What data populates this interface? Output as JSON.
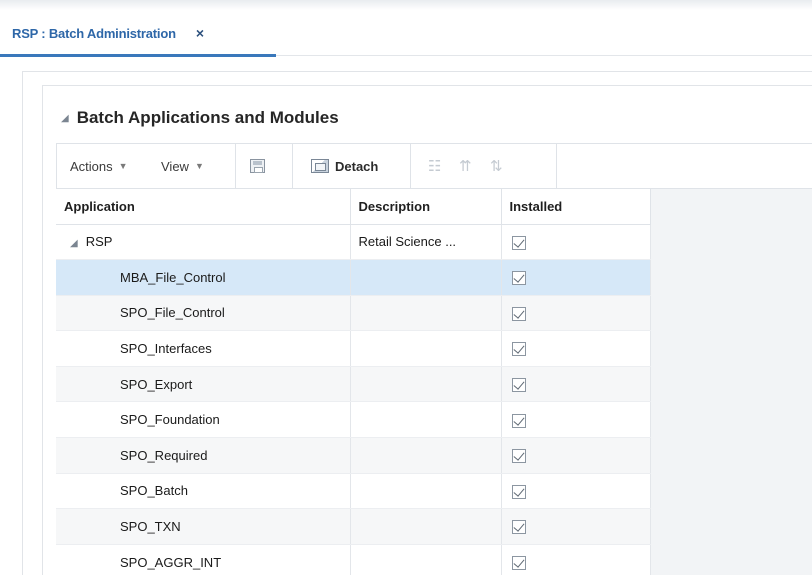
{
  "tabs": [
    {
      "label": "RSP : Batch Administration",
      "close_label": "×",
      "active": true
    }
  ],
  "section": {
    "title": "Batch Applications and Modules",
    "collapse_icon": "triangle-down-icon"
  },
  "toolbar": {
    "actions_label": "Actions",
    "view_label": "View",
    "detach_label": "Detach",
    "icons": [
      "save-icon",
      "detach-icon",
      "freeze-icon",
      "wrap-icon",
      "reorder-columns-icon"
    ]
  },
  "table": {
    "columns": [
      "Application",
      "Description",
      "Installed"
    ],
    "rows": [
      {
        "application": "RSP",
        "description": "Retail Science ...",
        "installed": true,
        "level": 0,
        "expanded": true
      },
      {
        "application": "MBA_File_Control",
        "description": "",
        "installed": true,
        "level": 1,
        "selected": true
      },
      {
        "application": "SPO_File_Control",
        "description": "",
        "installed": true,
        "level": 1
      },
      {
        "application": "SPO_Interfaces",
        "description": "",
        "installed": true,
        "level": 1
      },
      {
        "application": "SPO_Export",
        "description": "",
        "installed": true,
        "level": 1
      },
      {
        "application": "SPO_Foundation",
        "description": "",
        "installed": true,
        "level": 1
      },
      {
        "application": "SPO_Required",
        "description": "",
        "installed": true,
        "level": 1
      },
      {
        "application": "SPO_Batch",
        "description": "",
        "installed": true,
        "level": 1
      },
      {
        "application": "SPO_TXN",
        "description": "",
        "installed": true,
        "level": 1
      },
      {
        "application": "SPO_AGGR_INT",
        "description": "",
        "installed": true,
        "level": 1
      }
    ]
  },
  "colors": {
    "tab_text": "#2e67a8",
    "tab_underline": "#3a78bb",
    "selected_row": "#d6e8f8",
    "alt_row": "#f6f7f8"
  }
}
